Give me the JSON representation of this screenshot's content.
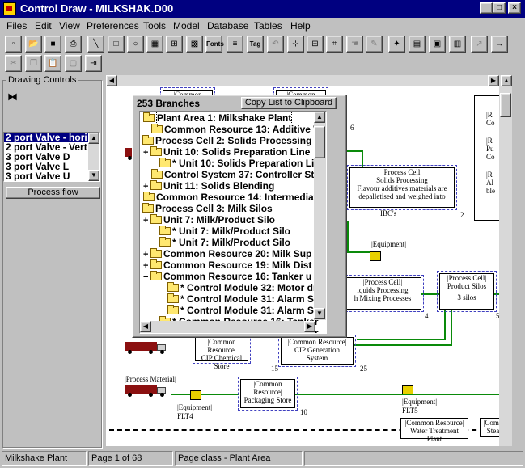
{
  "window": {
    "app_name": "Control Draw",
    "file_name": "MILKSHAK.D00",
    "title": "Control Draw - MILKSHAK.D00"
  },
  "menu": [
    "Files",
    "Edit",
    "View",
    "Preferences",
    "Tools",
    "Model",
    "Database",
    "Tables",
    "Help"
  ],
  "toolbar": {
    "fonts_label": "Fonts",
    "tag_label": "Tag"
  },
  "left_panel": {
    "title": "Drawing Controls",
    "shapes": [
      "2 port Valve - hori",
      "2 port Valve - Vert",
      "3 port Valve D",
      "3 port Valve L",
      "3 port Valve U"
    ],
    "selected_index": 0,
    "button": "Process flow"
  },
  "popup": {
    "header": "253 Branches",
    "copy_button": "Copy List to Clipboard",
    "tree": [
      {
        "exp": "",
        "text": "Plant Area  1: Milkshake Plant",
        "indent": 0,
        "sel": true
      },
      {
        "exp": "",
        "text": "Common Resource  13: Additive W",
        "indent": 1
      },
      {
        "exp": "−",
        "text": "Process Cell  2: Solids Processing",
        "indent": 0
      },
      {
        "exp": "+",
        "text": "Unit  10: Solids Preparation Line",
        "indent": 1
      },
      {
        "exp": "",
        "text": "* Unit  10: Solids Preparation Lin",
        "indent": 2
      },
      {
        "exp": "",
        "text": "Control System  37: Controller St",
        "indent": 1
      },
      {
        "exp": "+",
        "text": "Unit  11: Solids Blending",
        "indent": 1
      },
      {
        "exp": "",
        "text": "Common Resource  14: Intermediat",
        "indent": 0
      },
      {
        "exp": "−",
        "text": "Process Cell  3: Milk Silos",
        "indent": 0
      },
      {
        "exp": "+",
        "text": "Unit  7: Milk/Product  Silo",
        "indent": 1
      },
      {
        "exp": "",
        "text": "* Unit  7: Milk/Product  Silo",
        "indent": 2
      },
      {
        "exp": "",
        "text": "* Unit  7: Milk/Product  Silo",
        "indent": 2
      },
      {
        "exp": "+",
        "text": "Common Resource  20: Milk Sup",
        "indent": 1
      },
      {
        "exp": "+",
        "text": "Common Resource  19: Milk Dist",
        "indent": 1
      },
      {
        "exp": "−",
        "text": "Common Resource  16: Tanker u",
        "indent": 1
      },
      {
        "exp": "",
        "text": "* Control Module  32: Motor dr",
        "indent": 3
      },
      {
        "exp": "",
        "text": "* Control Module  31: Alarm Sw",
        "indent": 3
      },
      {
        "exp": "",
        "text": "* Control Module  31: Alarm Sw",
        "indent": 3
      },
      {
        "exp": "",
        "text": "* Common Resource  16: Tanker",
        "indent": 2
      },
      {
        "exp": "",
        "text": "* Common Resource  16: Tanker",
        "indent": 2
      }
    ]
  },
  "canvas": {
    "solids_box": {
      "title": "|Process Cell|",
      "name": "Solids Processing",
      "desc": "Flavour additives materials are depalletised and weighed into",
      "tag": "IBC's"
    },
    "product_silos": {
      "title": "|Process Cell|",
      "name": "Product Silos",
      "desc": "3 silos"
    },
    "liquids_box": {
      "title": "|Process Cell|",
      "name": "iquids Processing",
      "desc": "h Mixing Processes"
    },
    "cip_chem": {
      "title": "|Common Resource|",
      "name": "CIP Chemical Store"
    },
    "cip_gen": {
      "title": "|Common Resource|",
      "name": "CIP Generation",
      "extra": "System"
    },
    "packaging": {
      "title": "|Common Resource|",
      "name": "Packaging Store"
    },
    "water": {
      "title": "|Common Resource|",
      "name": "Water Treatment",
      "extra": "Plant"
    },
    "steam": {
      "title": "|Commo",
      "name": "Steam"
    },
    "process_material": "|Process Material|",
    "equipment": "|Equipment|",
    "flt4": "FLT4",
    "flt5": "FLT5",
    "top_left_box": "|Common Resource|",
    "top_right_box": "|Common Resource|",
    "page_nums": [
      "6",
      "2",
      "4",
      "5",
      "15",
      "25",
      "10",
      "14"
    ],
    "side_items": [
      "|R",
      "Co",
      "|R",
      "Pu",
      "Co",
      "|R",
      "Al",
      "ble"
    ]
  },
  "status": {
    "left": "Milkshake Plant",
    "page": "Page 1 of 68",
    "page_class": "Page class - Plant Area"
  }
}
